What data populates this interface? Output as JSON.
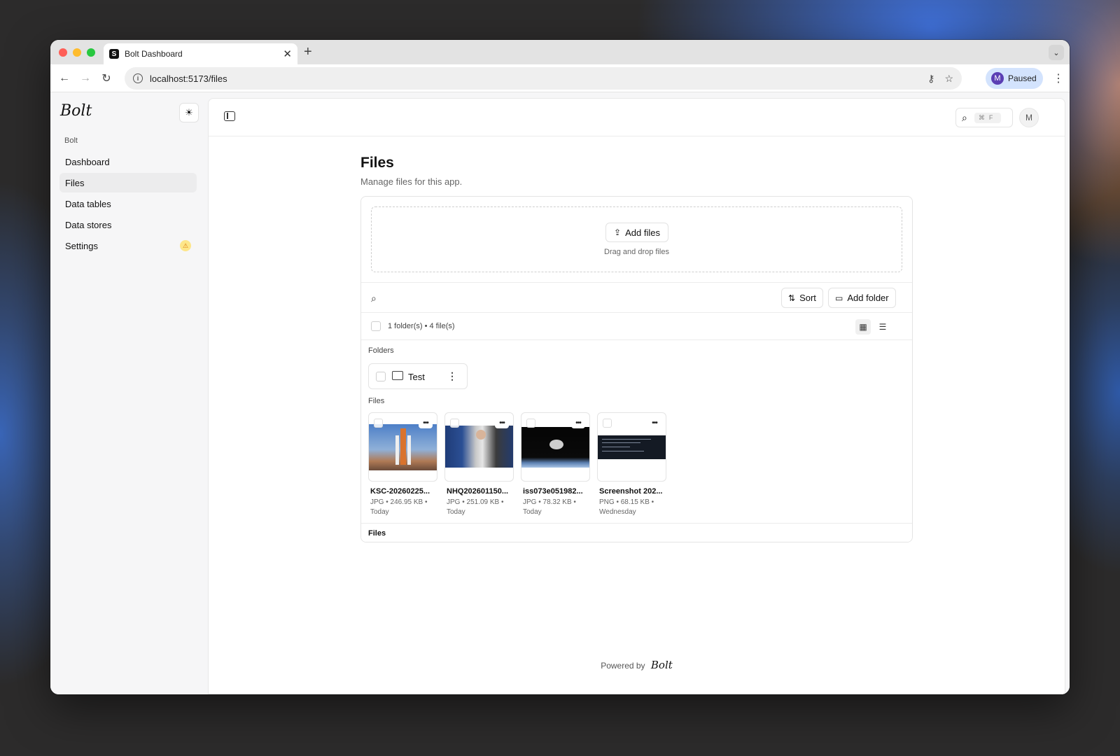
{
  "browser": {
    "tab_title": "Bolt Dashboard",
    "tab_favicon": "S",
    "url": "localhost:5173/files",
    "profile_initial": "M",
    "profile_label": "Paused"
  },
  "sidebar": {
    "brand": "Bolt",
    "group_label": "Bolt",
    "items": [
      {
        "label": "Dashboard"
      },
      {
        "label": "Files"
      },
      {
        "label": "Data tables"
      },
      {
        "label": "Data stores"
      },
      {
        "label": "Settings"
      }
    ]
  },
  "topbar": {
    "search_shortcut": "⌘F",
    "user_initial": "M"
  },
  "page": {
    "title": "Files",
    "subtitle": "Manage files for this app."
  },
  "upload": {
    "button_label": "Add files",
    "hint": "Drag and drop files"
  },
  "toolbar": {
    "sort_label": "Sort",
    "add_folder_label": "Add folder"
  },
  "summary": "1 folder(s) • 4 file(s)",
  "folders_label": "Folders",
  "folders": [
    {
      "name": "Test"
    }
  ],
  "files_label": "Files",
  "files": [
    {
      "name": "KSC-20260225...",
      "meta1": "JPG • 246.95 KB •",
      "meta2": "Today"
    },
    {
      "name": "NHQ202601150...",
      "meta1": "JPG • 251.09 KB •",
      "meta2": "Today"
    },
    {
      "name": "iss073e051982...",
      "meta1": "JPG • 78.32 KB •",
      "meta2": "Today"
    },
    {
      "name": "Screenshot 202...",
      "meta1": "PNG • 68.15 KB •",
      "meta2": "Wednesday"
    }
  ],
  "footer_label": "Files",
  "powered_by": "Powered by",
  "powered_logo": "Bolt"
}
